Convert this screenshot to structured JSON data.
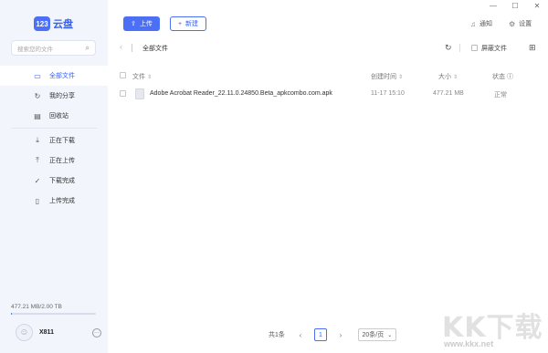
{
  "window": {
    "minimize": "—",
    "maximize": "☐",
    "close": "✕"
  },
  "app": {
    "logo_mark": "123",
    "logo_text": "云盘"
  },
  "search": {
    "placeholder": "搜索您的文件"
  },
  "sidebar": {
    "items": [
      {
        "label": "全部文件",
        "icon": "folder-icon",
        "active": true
      },
      {
        "label": "我的分享",
        "icon": "share-icon"
      },
      {
        "label": "回收站",
        "icon": "trash-icon"
      },
      {
        "label": "正在下载",
        "icon": "download-icon"
      },
      {
        "label": "正在上传",
        "icon": "upload-icon"
      },
      {
        "label": "下载完成",
        "icon": "check-circle-icon"
      },
      {
        "label": "上传完成",
        "icon": "file-done-icon"
      }
    ],
    "storage_text": "477.21 MB/2.00 TB",
    "storage_used_fraction": 0.0002,
    "username": "X811"
  },
  "toolbar": {
    "upload_label": "上传",
    "new_label": "新建",
    "notify_label": "通知",
    "settings_label": "设置"
  },
  "breadcrumb": {
    "current": "全部文件",
    "hide_label": "屏蔽文件"
  },
  "table": {
    "headers": {
      "name": "文件",
      "created": "创建时间",
      "size": "大小",
      "status": "状态"
    },
    "rows": [
      {
        "name": "Adobe Acrobat Reader_22.11.0.24850.Beta_apkcombo.com.apk",
        "created": "11-17 15:10",
        "size": "477.21 MB",
        "status": "正常"
      }
    ]
  },
  "pagination": {
    "total": "共1条",
    "page": "1",
    "page_size": "20条/页"
  },
  "watermark": {
    "text": "KK下载",
    "url": "www.kkx.net"
  },
  "colors": {
    "accent": "#4b70f5",
    "sidebar_bg": "#f3f5fc"
  }
}
